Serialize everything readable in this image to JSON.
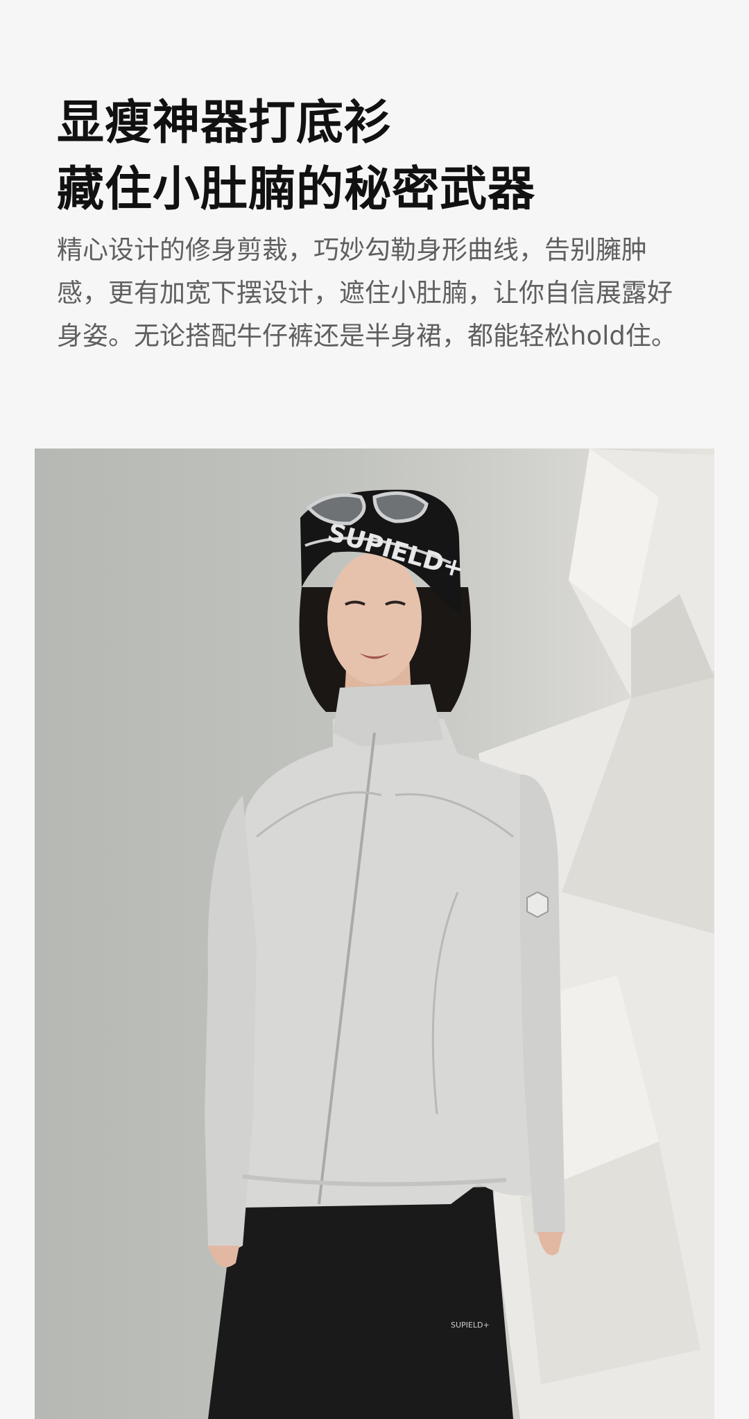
{
  "headline": {
    "line1": "显瘦神器打底衫",
    "line2": "藏住小肚腩的秘密武器"
  },
  "description": "精心设计的修身剪裁，巧妙勾勒身形曲线，告别臃肿感，更有加宽下摆设计，遮住小肚腩，让你自信展露好身姿。无论搭配牛仔裤还是半身裙，都能轻松hold住。",
  "photo": {
    "beanie_text": "SUPIELD+",
    "pants_label": "SUPIELD+",
    "colors": {
      "backdrop": "#c1c3bf",
      "paper": "#ecebe7",
      "jacket": "#d8d9d7",
      "beanie": "#151515",
      "pants": "#1a1a1a",
      "skin": "#e6c2ac"
    }
  }
}
